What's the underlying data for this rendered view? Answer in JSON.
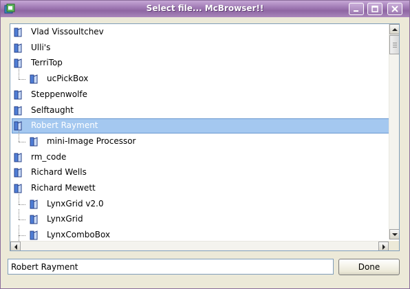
{
  "window": {
    "title": "Select file... McBrowser!!",
    "controls": [
      "minimize",
      "maximize",
      "close"
    ],
    "title_color": "#ffffff",
    "titlebar_color": "#a17bb5"
  },
  "tree": {
    "selected_color": "#a4c8f0",
    "items": [
      {
        "label": "Vlad Vissoultchev",
        "level": 0,
        "icon": "folder-icon",
        "selected": false
      },
      {
        "label": "Ulli's",
        "level": 0,
        "icon": "folder-icon",
        "selected": false
      },
      {
        "label": "TerriTop",
        "level": 0,
        "icon": "folder-icon",
        "selected": false
      },
      {
        "label": "ucPickBox",
        "level": 1,
        "icon": "folder-icon",
        "selected": false
      },
      {
        "label": "Steppenwolfe",
        "level": 0,
        "icon": "folder-icon",
        "selected": false
      },
      {
        "label": "Selftaught",
        "level": 0,
        "icon": "folder-icon",
        "selected": false
      },
      {
        "label": "Robert Rayment",
        "level": 0,
        "icon": "folder-icon",
        "selected": true
      },
      {
        "label": "mini-Image Processor",
        "level": 1,
        "icon": "folder-icon",
        "selected": false
      },
      {
        "label": "rm_code",
        "level": 0,
        "icon": "folder-icon",
        "selected": false
      },
      {
        "label": "Richard Wells",
        "level": 0,
        "icon": "folder-icon",
        "selected": false
      },
      {
        "label": "Richard Mewett",
        "level": 0,
        "icon": "folder-icon",
        "selected": false
      },
      {
        "label": "LynxGrid v2.0",
        "level": 1,
        "icon": "folder-icon",
        "selected": false
      },
      {
        "label": "LynxGrid",
        "level": 1,
        "icon": "folder-icon",
        "selected": false
      },
      {
        "label": "LynxComboBox",
        "level": 1,
        "icon": "folder-icon",
        "selected": false
      }
    ]
  },
  "footer": {
    "path_value": "Robert Rayment",
    "done_label": "Done"
  }
}
